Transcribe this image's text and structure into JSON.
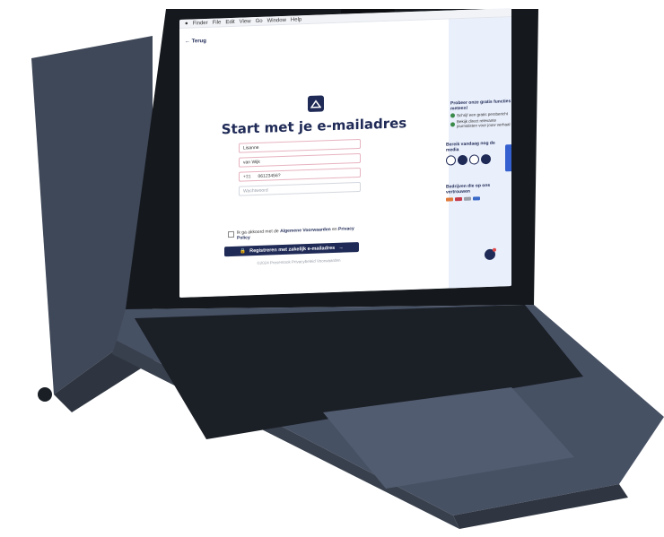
{
  "colors": {
    "brand": "#1f2a56",
    "accent_green": "#3a8a4a",
    "right_pane_bg": "#e9effb",
    "laptop_body": "#4a5465",
    "keyboard": "#20252d"
  },
  "menubar": {
    "apple_icon": "apple-icon",
    "items": [
      "Finder",
      "File",
      "Edit",
      "View",
      "Go",
      "Window",
      "Help"
    ]
  },
  "page": {
    "back_label": "← Terug",
    "title": "Start met je e-mailadres",
    "first_name": "Lisanne",
    "last_name": "van Wijk",
    "phone_prefix": "+31",
    "phone": "06123456?",
    "password_placeholder": "Wachtwoord",
    "consent_prefix": "Ik ga akkoord met de",
    "consent_terms": "Algemene Voorwaarden",
    "consent_and": "en",
    "consent_privacy": "Privacy Policy",
    "register_label": "Registreren met zakelijk e-mailadres",
    "register_arrow": "→",
    "footer": "©2024 Presentook Privacybeleid Voorwaarden"
  },
  "right": {
    "try_heading": "Probeer onze gratis functies meteen!",
    "try_items": [
      "Schrijf een gratis persbericht",
      "Bekijk direct relevante journalisten voor jouw verhaal"
    ],
    "media_heading": "Bereik vandaag nog de media",
    "companies_heading": "Bedrijven die op ons vertrouwen"
  }
}
